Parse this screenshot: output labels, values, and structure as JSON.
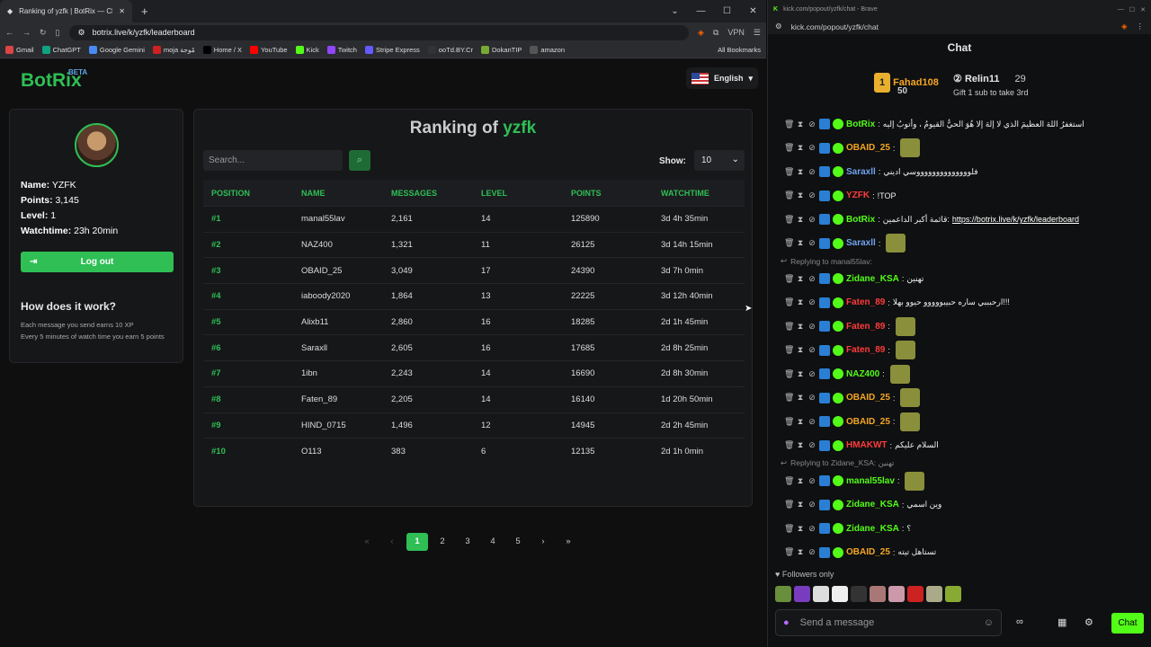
{
  "browser": {
    "tab_title": "Ranking of yzfk | BotRix — Cl...",
    "url": "botrix.live/k/yzfk/leaderboard",
    "vpn": "VPN"
  },
  "bookmarks": [
    {
      "label": "Gmail",
      "color": "#d44"
    },
    {
      "label": "ChatGPT",
      "color": "#10a37f"
    },
    {
      "label": "Google Gemini",
      "color": "#4a8af4"
    },
    {
      "label": "moja مُوجة",
      "color": "#c22"
    },
    {
      "label": "Home / X",
      "color": "#000"
    },
    {
      "label": "YouTube",
      "color": "#f00"
    },
    {
      "label": "Kick",
      "color": "#53fc18"
    },
    {
      "label": "Twitch",
      "color": "#9146ff"
    },
    {
      "label": "Stripe Express",
      "color": "#635bff"
    },
    {
      "label": "ooTd.BY.Cr",
      "color": "#333"
    },
    {
      "label": "DokanTIP",
      "color": "#7a3"
    },
    {
      "label": "amazon",
      "color": "#555"
    }
  ],
  "all_bookmarks": "All Bookmarks",
  "site": {
    "logo": "BotRix",
    "beta": "BETA",
    "language": "English"
  },
  "profile": {
    "name_label": "Name:",
    "name": "YZFK",
    "points_label": "Points:",
    "points": "3,145",
    "level_label": "Level:",
    "level": "1",
    "watch_label": "Watchtime:",
    "watchtime": "23h 20min",
    "logout": "Log out",
    "how_title": "How does it work?",
    "hint1": "Each message you send earns 10 XP",
    "hint2": "Every 5 minutes of watch time you earn 5 points"
  },
  "ranking": {
    "title_prefix": "Ranking of",
    "channel": "yzfk",
    "search_placeholder": "Search...",
    "show_label": "Show:",
    "show_value": "10",
    "headers": [
      "POSITION",
      "NAME",
      "MESSAGES",
      "LEVEL",
      "POINTS",
      "WATCHTIME"
    ],
    "rows": [
      [
        "#1",
        "manal55lav",
        "2,161",
        "14",
        "125890",
        "3d 4h 35min"
      ],
      [
        "#2",
        "NAZ400",
        "1,321",
        "11",
        "26125",
        "3d 14h 15min"
      ],
      [
        "#3",
        "OBAID_25",
        "3,049",
        "17",
        "24390",
        "3d 7h 0min"
      ],
      [
        "#4",
        "iaboody2020",
        "1,864",
        "13",
        "22225",
        "3d 12h 40min"
      ],
      [
        "#5",
        "Alixb11",
        "2,860",
        "16",
        "18285",
        "2d 1h 45min"
      ],
      [
        "#6",
        "Saraxll",
        "2,605",
        "16",
        "17685",
        "2d 8h 25min"
      ],
      [
        "#7",
        "1ibn",
        "2,243",
        "14",
        "16690",
        "2d 8h 30min"
      ],
      [
        "#8",
        "Faten_89",
        "2,205",
        "14",
        "16140",
        "1d 20h 50min"
      ],
      [
        "#9",
        "HIND_0715",
        "1,496",
        "12",
        "14945",
        "2d 2h 45min"
      ],
      [
        "#10",
        "O113",
        "383",
        "6",
        "12135",
        "2d 1h 0min"
      ]
    ],
    "pages": [
      "1",
      "2",
      "3",
      "4",
      "5"
    ]
  },
  "chat_window": {
    "title": "kick.com/popout/yzfk/chat - Brave",
    "url": "kick.com/popout/yzfk/chat",
    "header": "Chat",
    "leader1_name": "Fahad108",
    "leader1_amt": "50",
    "leader1_rank": "1",
    "leader2_name": "Relin11",
    "leader2_amt": "29",
    "leader3": "Gift 1 sub to take 3rd",
    "messages": [
      {
        "user": "BotRix",
        "color": "#53fc18",
        "text": "استغفرُ اللهَ العظيمَ الذي لا إلهَ إلا هُوَ الحيُّ القيومُ ، وأتوبُ إليه"
      },
      {
        "user": "OBAID_25",
        "color": "#f5a623",
        "text": ""
      },
      {
        "user": "Saraxll",
        "color": "#6fa3ef",
        "text": "فلووووووووووووووسي اديني"
      },
      {
        "user": "YZFK",
        "color": "#ff3b3b",
        "text": "!TOP"
      },
      {
        "user": "BotRix",
        "color": "#53fc18",
        "text": "قائمة أكبر الداعمين: ",
        "link": "https://botrix.live/k/yzfk/leaderboard"
      },
      {
        "user": "Saraxll",
        "color": "#6fa3ef",
        "text": ""
      },
      {
        "reply": "Replying to manal55lav:"
      },
      {
        "user": "Zidane_KSA",
        "color": "#53fc18",
        "text": "تهنين"
      },
      {
        "user": "Faten_89",
        "color": "#ff3b3b",
        "text": "ارحبببي ساره حبيبووووو حيوو بهلا!!!"
      },
      {
        "user": "Faten_89",
        "color": "#ff3b3b",
        "text": ""
      },
      {
        "user": "Faten_89",
        "color": "#ff3b3b",
        "text": ""
      },
      {
        "user": "NAZ400",
        "color": "#53fc18",
        "text": ""
      },
      {
        "user": "OBAID_25",
        "color": "#f5a623",
        "text": ""
      },
      {
        "user": "OBAID_25",
        "color": "#f5a623",
        "text": ""
      },
      {
        "user": "HMAKWT",
        "color": "#ff3b3b",
        "text": "السلام عليكم"
      },
      {
        "reply": "Replying to Zidane_KSA: تهنين"
      },
      {
        "user": "manal55lav",
        "color": "#53fc18",
        "text": ""
      },
      {
        "user": "Zidane_KSA",
        "color": "#53fc18",
        "text": "وين اسمي"
      },
      {
        "user": "Zidane_KSA",
        "color": "#53fc18",
        "text": "؟"
      },
      {
        "user": "OBAID_25",
        "color": "#f5a623",
        "text": "تستاهل تيته"
      }
    ],
    "followers_only": "Followers only",
    "input_placeholder": "Send a message",
    "send": "Chat"
  }
}
